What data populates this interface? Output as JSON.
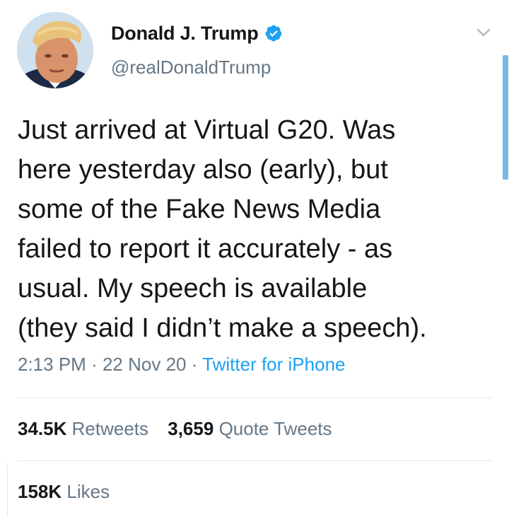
{
  "author": {
    "display_name": "Donald J. Trump",
    "handle": "@realDonaldTrump",
    "verified": true,
    "avatar_icon": "profile-photo"
  },
  "tweet": {
    "text_lines": [
      "Just arrived at Virtual G20. Was",
      "here yesterday also (early), but",
      "some of the Fake News Media",
      "failed to report it accurately - as",
      "usual. My speech is available",
      "(they said I didn’t make a speech)."
    ],
    "time": "2:13 PM",
    "date": "22 Nov 20",
    "separator": "·",
    "source": "Twitter for iPhone"
  },
  "stats": {
    "retweets_count": "34.5K",
    "retweets_label": "Retweets",
    "quotes_count": "3,659",
    "quotes_label": "Quote Tweets",
    "likes_count": "158K",
    "likes_label": "Likes"
  },
  "icons": {
    "verified": "verified-badge-icon",
    "more": "chevron-down-icon"
  },
  "colors": {
    "text_primary": "#14171a",
    "text_secondary": "#657786",
    "accent": "#1da1f2",
    "divider": "#e1e8ed"
  }
}
